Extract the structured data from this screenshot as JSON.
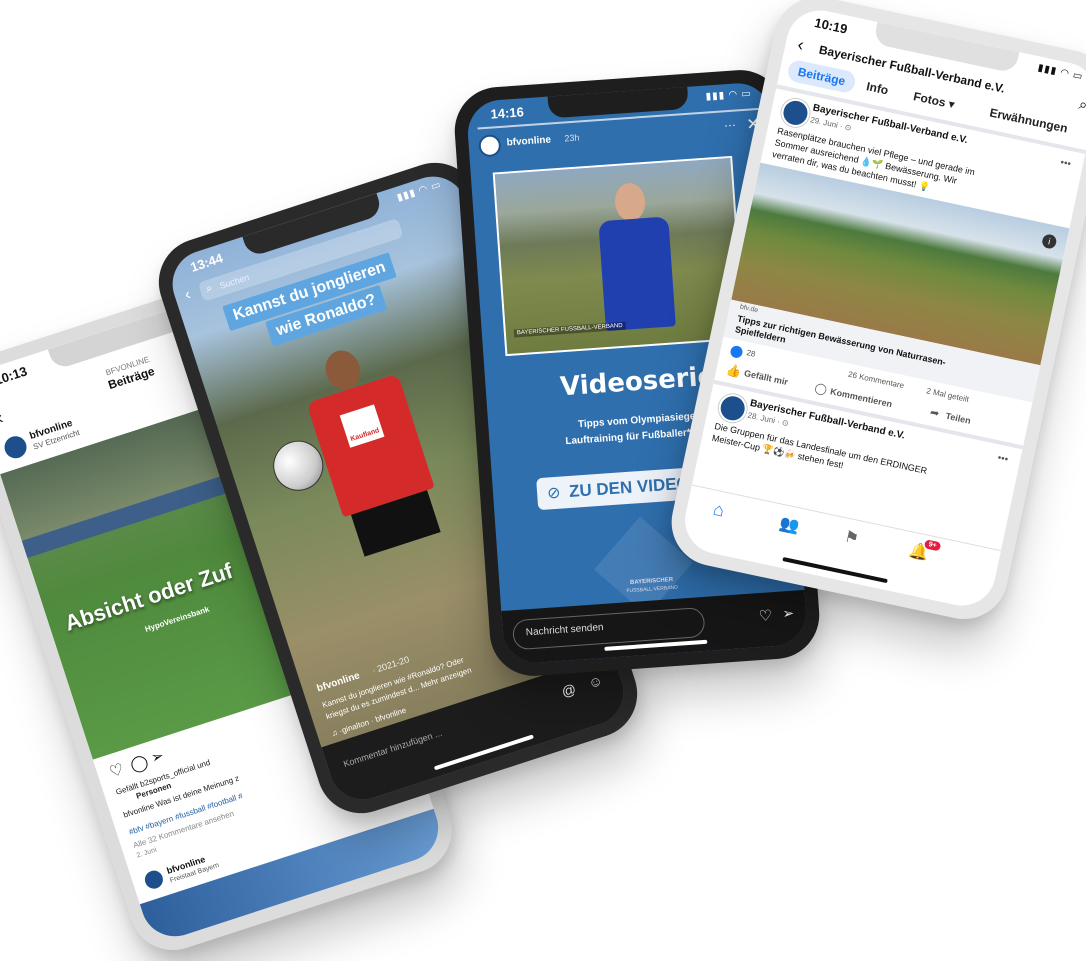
{
  "colors": {
    "facebook_blue": "#1877f2",
    "story_blue": "#2f6fae",
    "reel_title_bg": "#5fa6e0",
    "jersey_red": "#d42a2a",
    "notification_red": "#e41e3f"
  },
  "phone1": {
    "status_time": "10:13",
    "header_top": "BFVONLINE",
    "header_title": "Beiträge",
    "account_name": "bfvonline",
    "account_sub": "SV Etzenricht",
    "overlay_text": "Absicht oder Zuf",
    "sponsor": "HypoVereinsbank",
    "liked_by": "Gefällt b2sports_official und",
    "liked_by_2": "Personen",
    "caption": "bfvonline Was ist deine Meinung z",
    "hashtags": "#bfv #bayern #fussball #football #",
    "comments_link": "Alle 32 Kommentare ansehen",
    "date": "2. Juni",
    "next_account": "bfvonline",
    "next_sub": "Freistaat Bayern",
    "icons": [
      "back-arrow-icon",
      "heart-icon",
      "comment-icon",
      "send-icon",
      "more-icon"
    ]
  },
  "phone2": {
    "status_time": "13:44",
    "search_placeholder": "Suchen",
    "title_line1": "Kannst du jonglieren",
    "title_line2": "wie Ronaldo?",
    "jersey_text": "Kaufland",
    "account": "bfvonline",
    "account_meta": "· 2021-20",
    "caption_line1": "Kannst du jonglieren wie #Ronaldo? Oder",
    "caption_line2": "kriegst du es zumindest d... Mehr anzeigen",
    "audio": "♫ ·ginalton · bfvonline",
    "comment_placeholder": "Kommentar hinzufügen ...",
    "icons": [
      "back-arrow-icon",
      "search-icon",
      "audio-icon",
      "mention-icon",
      "emoji-icon"
    ]
  },
  "phone3": {
    "status_time": "14:16",
    "account": "bfvonline",
    "time_ago": "23h",
    "video_caption": "BAYERISCHER FUSSBALL-VERBAND",
    "title": "Videoserie",
    "subtitle_line1": "Tipps vom Olympiasieger:",
    "subtitle_line2": "Lauftraining für Fußballer*innen",
    "cta": "ZU DEN VIDEOS",
    "logo_line1": "BAYERISCHER",
    "logo_line2": "FUSSBALL-VERBAND",
    "message_placeholder": "Nachricht senden",
    "icons": [
      "more-icon",
      "close-icon",
      "link-icon",
      "heart-icon",
      "send-icon"
    ]
  },
  "phone4": {
    "status_time": "10:19",
    "page_title": "Bayerischer Fußball-Verband e.V.",
    "tabs": [
      "Beiträge",
      "Info",
      "Fotos ▾",
      "Erwähnungen"
    ],
    "post1": {
      "author": "Bayerischer Fußball-Verband e.V.",
      "date": "29. Juni · ⊙",
      "text_line1": "Rasenplätze brauchen viel Pflege – und gerade im",
      "text_line2": "Sommer ausreichend 💧🌱 Bewässerung. Wir",
      "text_line3": "verraten dir, was du beachten musst! 💡",
      "link_domain": "bfv.de",
      "link_title_line1": "Tipps zur richtigen Bewässerung von Naturrasen-",
      "link_title_line2": "Spielfeldern",
      "reactions": "28",
      "comments": "26 Kommentare",
      "shares": "2 Mal geteilt",
      "like_label": "Gefällt mir",
      "comment_label": "Kommentieren",
      "share_label": "Teilen"
    },
    "post2": {
      "author": "Bayerischer Fußball-Verband e.V.",
      "date": "28. Juni · ⊙",
      "text_line1": "Die Gruppen für das Landesfinale um den ERDINGER",
      "text_line2": "Meister-Cup 🏆⚽🍻 stehen fest!"
    },
    "notification_badge": "9+",
    "icons": [
      "back-arrow-icon",
      "search-icon",
      "home-icon",
      "friends-icon",
      "flag-icon",
      "bell-icon"
    ]
  }
}
